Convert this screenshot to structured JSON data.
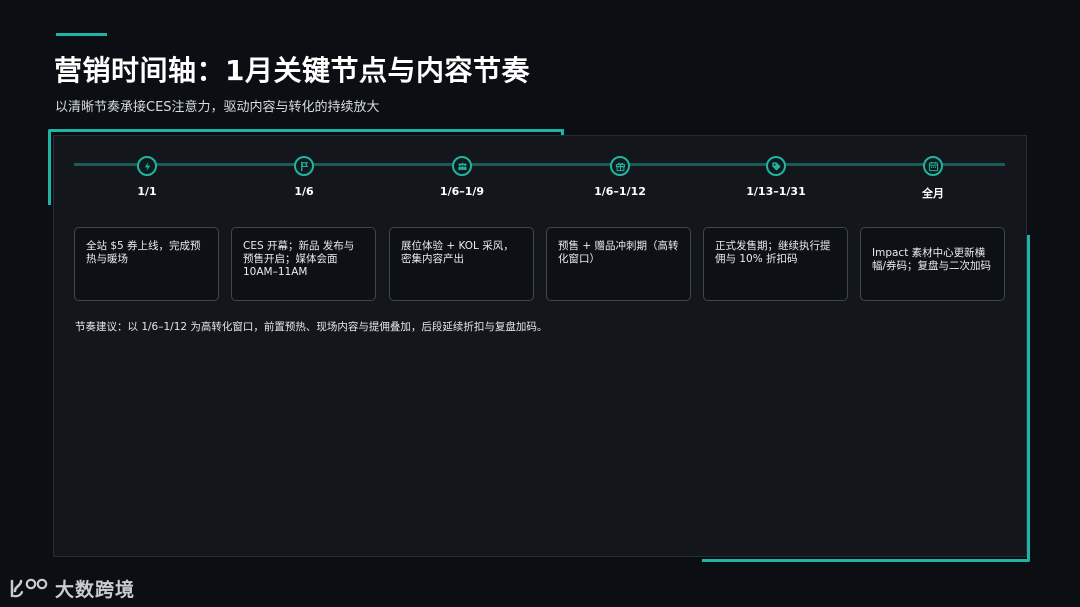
{
  "header": {
    "title": "营销时间轴：1月关键节点与内容节奏",
    "subtitle": "以清晰节奏承接CES注意力，驱动内容与转化的持续放大"
  },
  "timeline": {
    "nodes": [
      {
        "icon": "lightning-icon",
        "date": "1/1",
        "text": "全站 $5 券上线，完成预热与暖场"
      },
      {
        "icon": "flag-icon",
        "date": "1/6",
        "text": "CES 开幕；新品 发布与预售开启；媒体会面 10AM–11AM"
      },
      {
        "icon": "users-icon",
        "date": "1/6–1/9",
        "text": "展位体验 + KOL 采风，密集内容产出"
      },
      {
        "icon": "gift-icon",
        "date": "1/6–1/12",
        "text": "预售 + 赠品冲刺期（高转化窗口）"
      },
      {
        "icon": "tag-icon",
        "date": "1/13–1/31",
        "text": "正式发售期；继续执行提佣与 10% 折扣码"
      },
      {
        "icon": "calendar-icon",
        "date": "全月",
        "text": "Impact 素材中心更新横幅/券码；复盘与二次加码"
      }
    ]
  },
  "note": "节奏建议：以 1/6–1/12 为高转化窗口，前置预热、现场内容与提佣叠加，后段延续折扣与复盘加码。",
  "brand": {
    "name": "大数跨境",
    "accent": "#1fb3a3"
  }
}
